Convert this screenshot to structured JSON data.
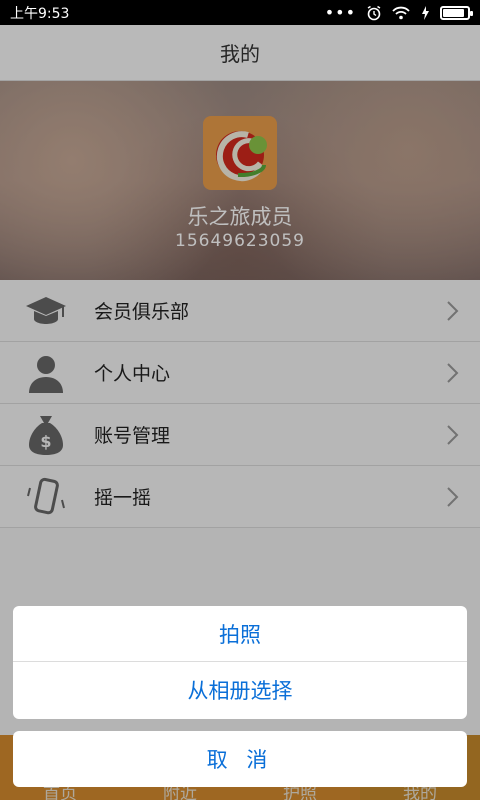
{
  "status_bar": {
    "time": "上午9:53",
    "dots": "•••"
  },
  "header": {
    "title": "我的"
  },
  "profile": {
    "name": "乐之旅成员",
    "phone": "15649623059"
  },
  "menu": [
    {
      "label": "会员俱乐部",
      "icon": "graduation-cap-icon"
    },
    {
      "label": "个人中心",
      "icon": "person-icon"
    },
    {
      "label": "账号管理",
      "icon": "money-bag-icon"
    },
    {
      "label": "摇一摇",
      "icon": "shake-phone-icon"
    }
  ],
  "tabbar": {
    "tabs": [
      "首页",
      "附近",
      "护照",
      "我的"
    ],
    "active_index": 3
  },
  "action_sheet": {
    "option1": "拍照",
    "option2": "从相册选择",
    "cancel": "取 消"
  },
  "colors": {
    "action_text": "#0a6fd8",
    "tab_active": "#e8a040",
    "logo_bg": "#e89c4a"
  }
}
